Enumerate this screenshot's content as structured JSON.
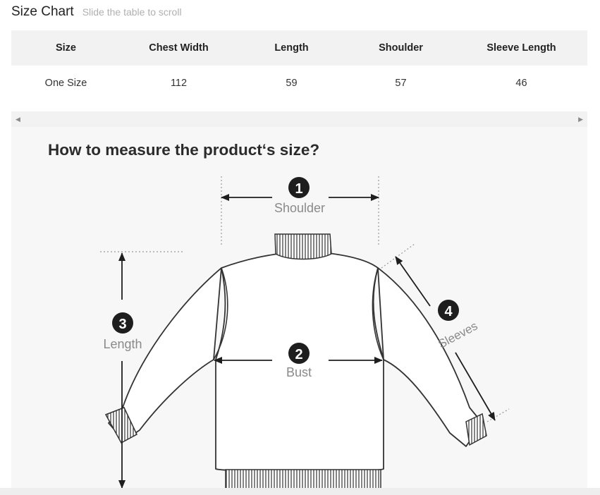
{
  "header": {
    "title": "Size Chart",
    "subtitle": "Slide the table to scroll"
  },
  "size_table": {
    "columns": [
      "Size",
      "Chest Width",
      "Length",
      "Shoulder",
      "Sleeve Length"
    ],
    "rows": [
      [
        "One Size",
        "112",
        "59",
        "57",
        "46"
      ]
    ]
  },
  "scrollbar": {
    "left_icon": "triangle-left-icon",
    "right_icon": "triangle-right-icon"
  },
  "measure_guide": {
    "title": "How to measure the product‘s size?",
    "measurements": [
      {
        "number": "1",
        "label": "Shoulder"
      },
      {
        "number": "2",
        "label": "Bust"
      },
      {
        "number": "3",
        "label": "Length"
      },
      {
        "number": "4",
        "label": "Sleeves"
      }
    ]
  },
  "colors": {
    "table_header_bg": "#f2f2f2",
    "panel_bg": "#f7f7f7",
    "label_gray": "#8a8a8a",
    "badge_dark": "#1e1e1e"
  }
}
